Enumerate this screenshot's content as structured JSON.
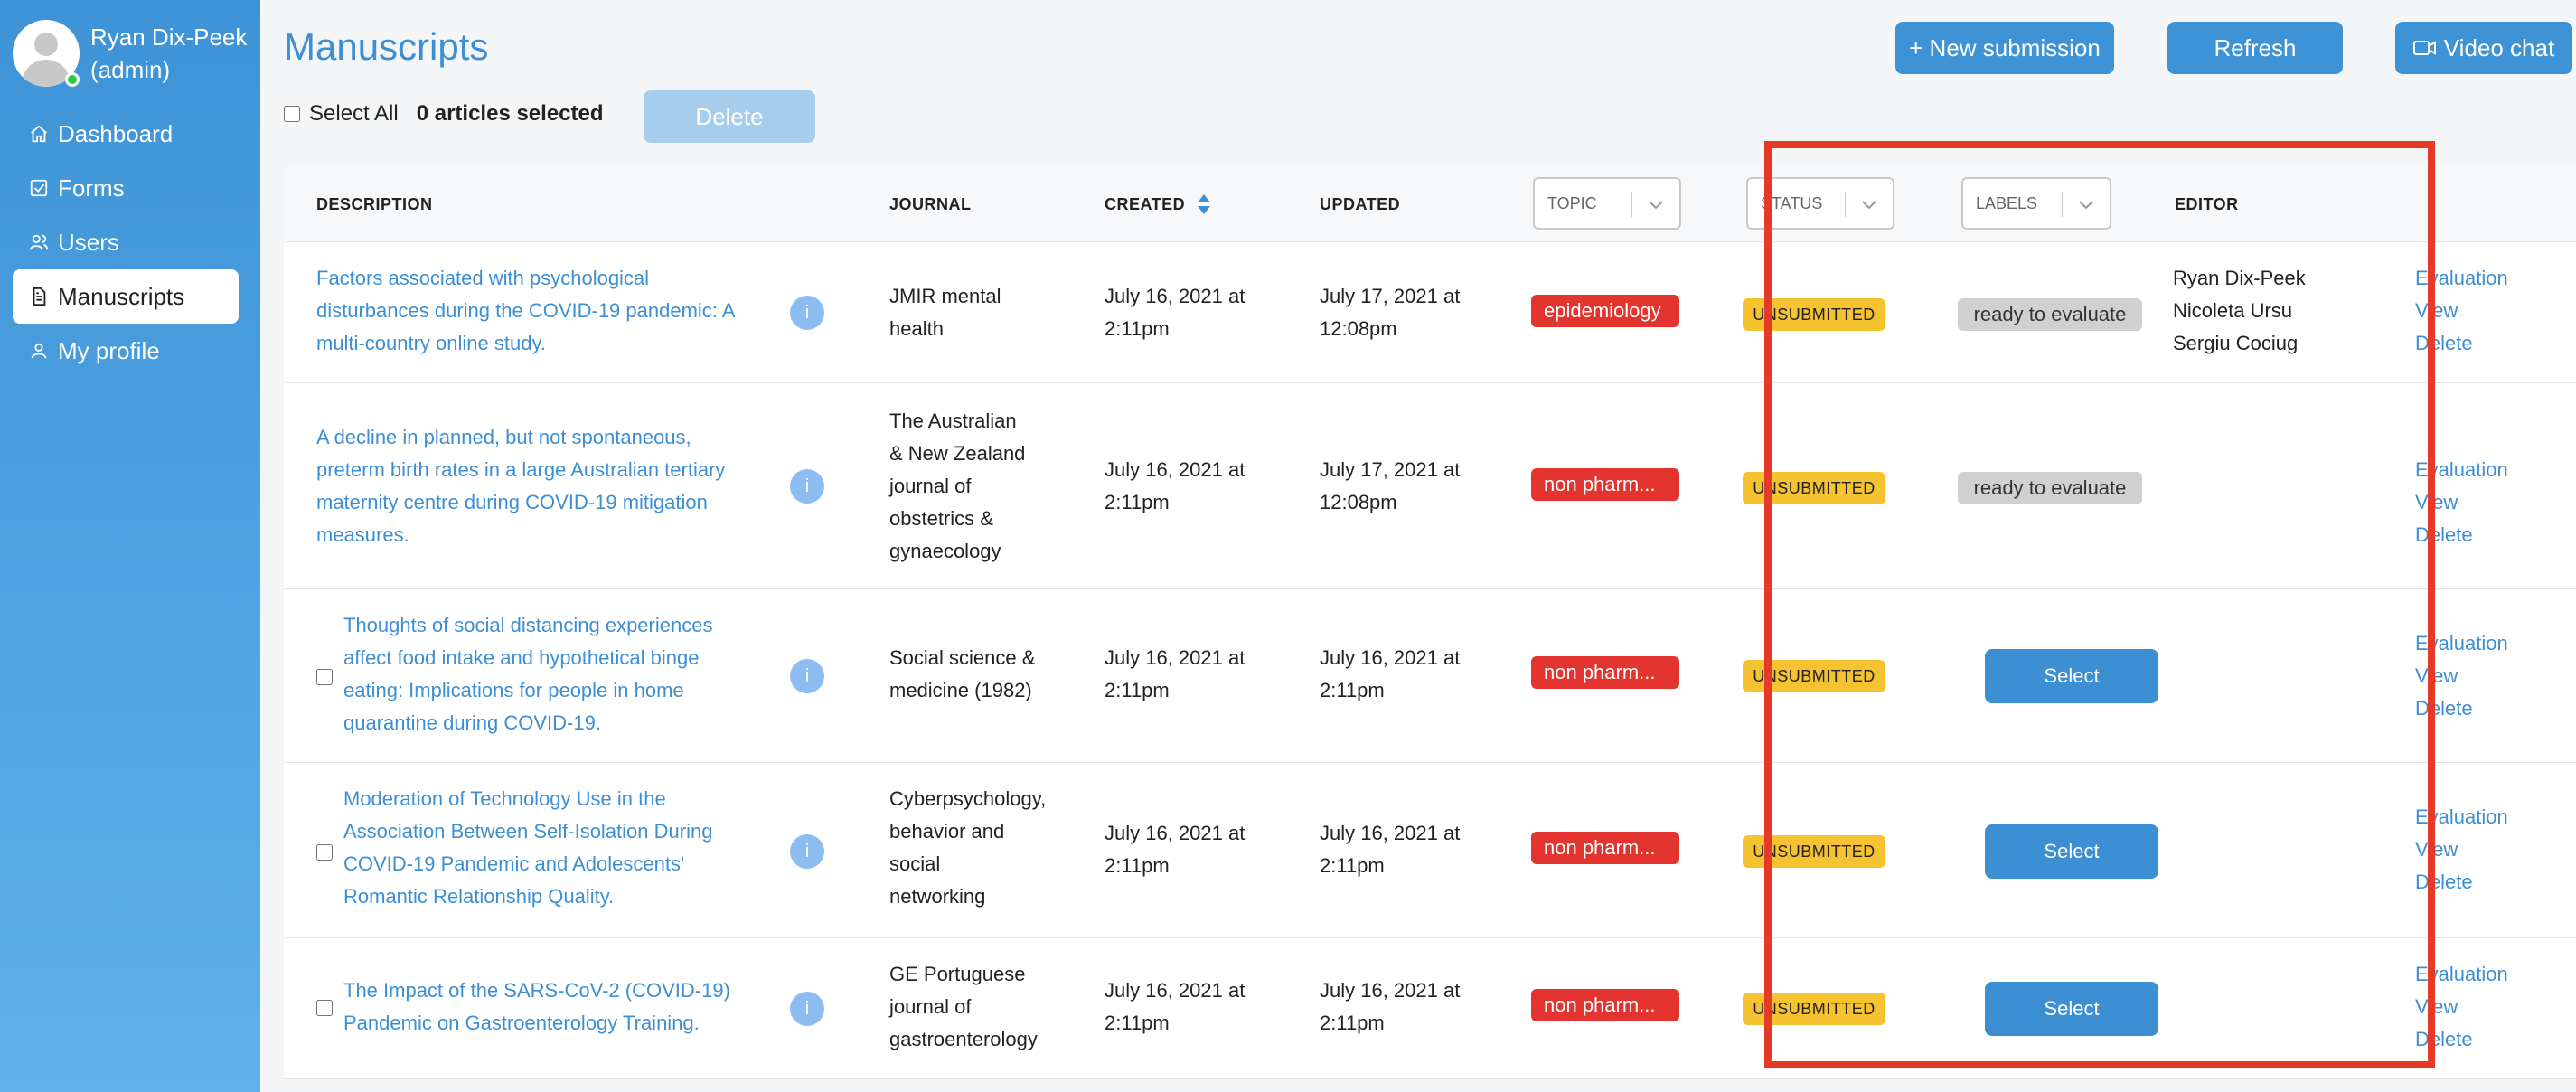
{
  "sidebar": {
    "user_name": "Ryan Dix-Peek",
    "user_role": "(admin)",
    "items": [
      {
        "label": "Dashboard",
        "icon": "home-icon"
      },
      {
        "label": "Forms",
        "icon": "checkbox-icon"
      },
      {
        "label": "Users",
        "icon": "users-icon"
      },
      {
        "label": "Manuscripts",
        "icon": "document-icon",
        "active": true
      },
      {
        "label": "My profile",
        "icon": "user-icon"
      }
    ]
  },
  "header": {
    "title": "Manuscripts",
    "new_submission": "+ New submission",
    "refresh": "Refresh",
    "video_chat": "Video chat"
  },
  "selection": {
    "select_all": "Select All",
    "count": "0 articles selected",
    "delete": "Delete"
  },
  "table": {
    "columns": {
      "description": "DESCRIPTION",
      "journal": "JOURNAL",
      "created": "CREATED",
      "updated": "UPDATED",
      "topic": "TOPIC",
      "status": "STATUS",
      "labels": "LABELS",
      "editor": "EDITOR"
    },
    "actions": {
      "evaluation": "Evaluation",
      "view": "View",
      "delete": "Delete"
    },
    "select_label": "Select",
    "rows": [
      {
        "description_lines": [
          "Factors associated with psychological",
          "disturbances during the COVID-19 pandemic: A",
          "multi-country online study."
        ],
        "journal_lines": [
          "JMIR mental",
          "health"
        ],
        "created_lines": [
          "July 16, 2021 at",
          "2:11pm"
        ],
        "updated_lines": [
          "July 17, 2021 at",
          "12:08pm"
        ],
        "topic": "epidemiology",
        "status": "UNSUBMITTED",
        "label": "ready to evaluate",
        "editors": [
          "Ryan Dix-Peek",
          "Nicoleta Ursu",
          "Sergiu Cociug"
        ]
      },
      {
        "description_lines": [
          "A decline in planned, but not spontaneous,",
          "preterm birth rates in a large Australian tertiary",
          "maternity centre during COVID-19 mitigation",
          "measures."
        ],
        "journal_lines": [
          "The Australian",
          "& New Zealand",
          "journal of",
          "obstetrics &",
          "gynaecology"
        ],
        "created_lines": [
          "July 16, 2021 at",
          "2:11pm"
        ],
        "updated_lines": [
          "July 17, 2021 at",
          "12:08pm"
        ],
        "topic": "non pharm...",
        "status": "UNSUBMITTED",
        "label": "ready to evaluate"
      },
      {
        "description_lines": [
          "Thoughts of social distancing experiences",
          "affect food intake and hypothetical binge",
          "eating: Implications for people in home",
          "quarantine during COVID-19."
        ],
        "journal_lines": [
          "Social science &",
          "medicine (1982)"
        ],
        "created_lines": [
          "July 16, 2021 at",
          "2:11pm"
        ],
        "updated_lines": [
          "July 16, 2021 at",
          "2:11pm"
        ],
        "topic": "non pharm...",
        "status": "UNSUBMITTED"
      },
      {
        "description_lines": [
          "Moderation of Technology Use in the",
          "Association Between Self-Isolation During",
          "COVID-19 Pandemic and Adolescents'",
          "Romantic Relationship Quality."
        ],
        "journal_lines": [
          "Cyberpsychology,",
          "behavior and",
          "social",
          "networking"
        ],
        "created_lines": [
          "July 16, 2021 at",
          "2:11pm"
        ],
        "updated_lines": [
          "July 16, 2021 at",
          "2:11pm"
        ],
        "topic": "non pharm...",
        "status": "UNSUBMITTED"
      },
      {
        "description_lines": [
          "The Impact of the SARS-CoV-2 (COVID-19)",
          "Pandemic on Gastroenterology Training."
        ],
        "journal_lines": [
          "GE Portuguese",
          "journal of",
          "gastroenterology"
        ],
        "created_lines": [
          "July 16, 2021 at",
          "2:11pm"
        ],
        "updated_lines": [
          "July 16, 2021 at",
          "2:11pm"
        ],
        "topic": "non pharm...",
        "status": "UNSUBMITTED"
      }
    ]
  },
  "colors": {
    "accent": "#3d8fd4",
    "topic_badge": "#e3342f",
    "status_badge": "#f5c230",
    "label_badge": "#d0d0d0",
    "highlight_box": "#e53a27"
  }
}
